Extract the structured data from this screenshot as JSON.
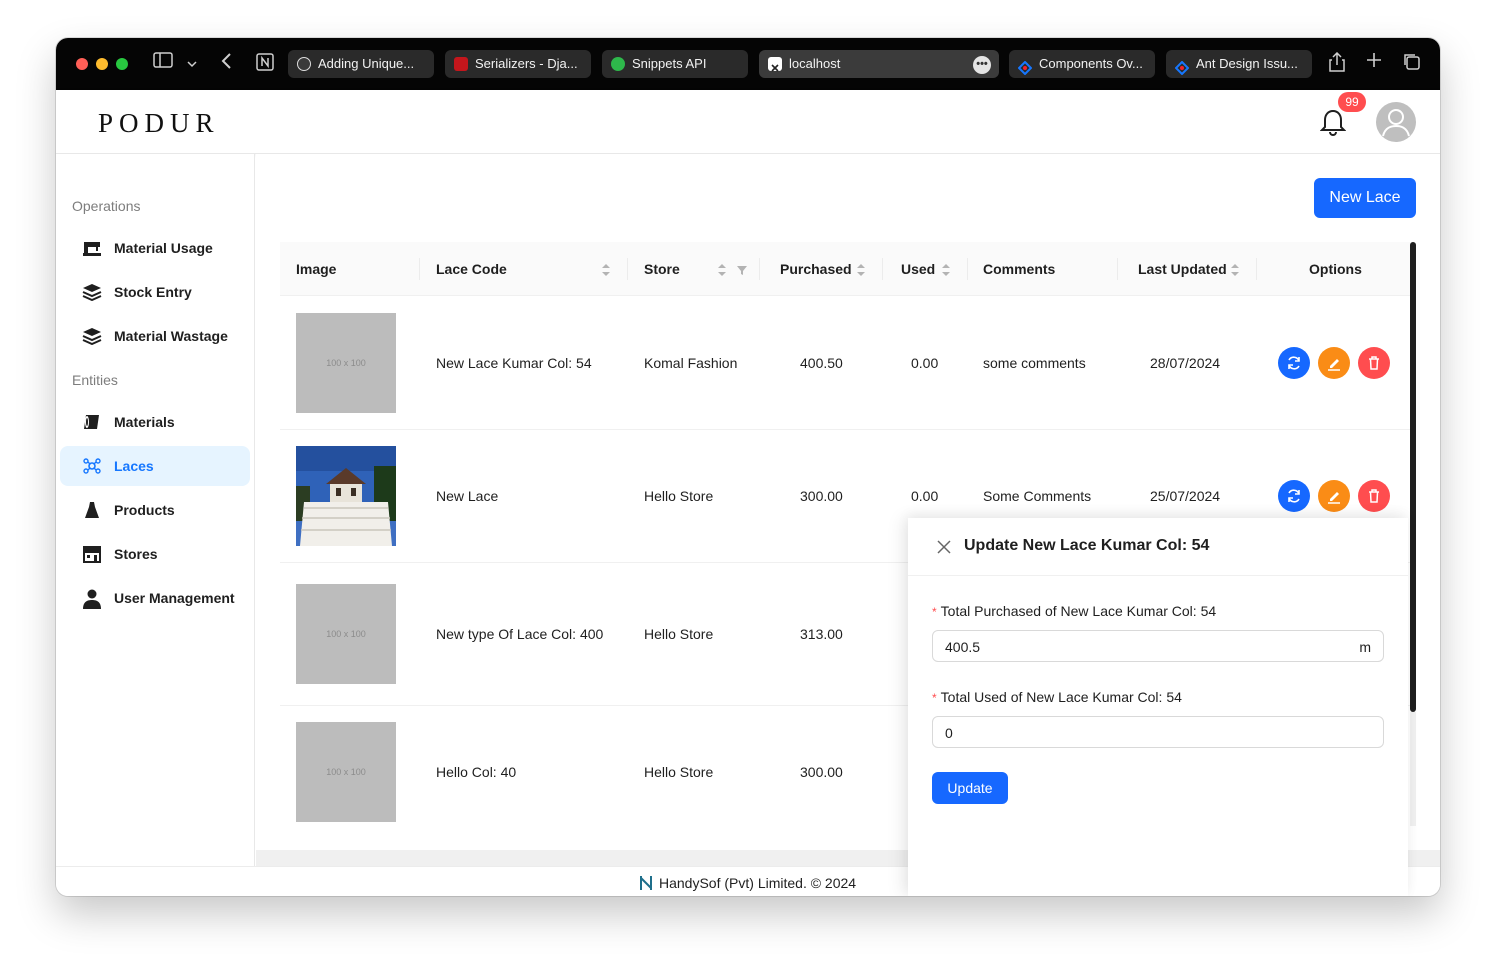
{
  "browser": {
    "tabs": [
      {
        "label": "Adding Unique...",
        "favicon_color": "#ffffff"
      },
      {
        "label": "Serializers - Dja...",
        "favicon_color": "#c4161c"
      },
      {
        "label": "Snippets API",
        "favicon_color": "#2eb84b"
      },
      {
        "label": "localhost",
        "favicon_color": "#ffffff"
      },
      {
        "label": "Components Ov...",
        "favicon_color": "#1677ff"
      },
      {
        "label": "Ant Design Issu...",
        "favicon_color": "#1677ff"
      }
    ],
    "active_tab_more": "•••"
  },
  "header": {
    "logo": "PODUR",
    "notification_count": "99"
  },
  "sidebar": {
    "groups": [
      {
        "title": "Operations"
      },
      {
        "title": "Entities"
      }
    ],
    "items": [
      {
        "label": "Material Usage",
        "icon": "sewing-machine-icon"
      },
      {
        "label": "Stock Entry",
        "icon": "layers-icon"
      },
      {
        "label": "Material Wastage",
        "icon": "layers-icon"
      },
      {
        "label": "Materials",
        "icon": "fabric-roll-icon"
      },
      {
        "label": "Laces",
        "icon": "lace-icon",
        "active": true
      },
      {
        "label": "Products",
        "icon": "dress-icon"
      },
      {
        "label": "Stores",
        "icon": "store-icon"
      },
      {
        "label": "User Management",
        "icon": "user-icon"
      }
    ]
  },
  "content": {
    "new_button": "New Lace",
    "table": {
      "columns": [
        "Image",
        "Lace Code",
        "Store",
        "Purchased",
        "Used",
        "Comments",
        "Last Updated",
        "Options"
      ],
      "rows": [
        {
          "image": "100 x 100",
          "code": "New Lace Kumar Col: 54",
          "store": "Komal Fashion",
          "purchased": "400.50",
          "used": "0.00",
          "comments": "some comments",
          "updated": "28/07/2024"
        },
        {
          "image": "photo",
          "code": "New Lace",
          "store": "Hello Store",
          "purchased": "300.00",
          "used": "0.00",
          "comments": "Some Comments",
          "updated": "25/07/2024"
        },
        {
          "image": "100 x 100",
          "code": "New type Of Lace Col: 400",
          "store": "Hello Store",
          "purchased": "313.00",
          "used": "",
          "comments": "",
          "updated": ""
        },
        {
          "image": "100 x 100",
          "code": "Hello Col: 40",
          "store": "Hello Store",
          "purchased": "300.00",
          "used": "",
          "comments": "",
          "updated": ""
        }
      ]
    }
  },
  "drawer": {
    "title": "Update New Lace Kumar Col: 54",
    "purchased_label": "Total Purchased of New Lace Kumar Col: 54",
    "purchased_value": "400.5",
    "purchased_suffix": "m",
    "used_label": "Total Used of New Lace Kumar Col: 54",
    "used_value": "0",
    "update_button": "Update",
    "required_mark": "*"
  },
  "footer": {
    "text": "HandySof (Pvt) Limited. © 2024"
  },
  "colors": {
    "primary": "#1668ff",
    "warning": "#fa8c16",
    "danger": "#ff4d4f",
    "active_bg": "#e6f4ff"
  }
}
